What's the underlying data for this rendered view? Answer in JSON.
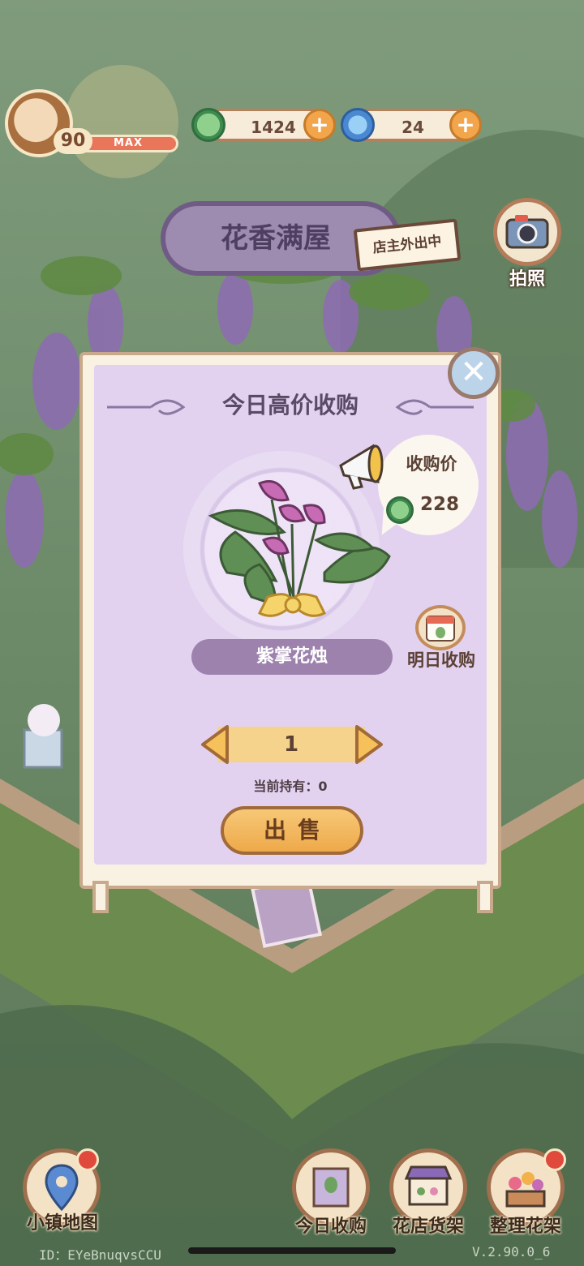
{
  "hud": {
    "level": "90",
    "level_status": "MAX",
    "currency_1": {
      "icon": "clover-coin-icon",
      "value": "1424"
    },
    "currency_2": {
      "icon": "swirl-gem-icon",
      "value": "24"
    }
  },
  "shop": {
    "name": "花香满屋",
    "status_sign": "店主外出中",
    "camera_label": "拍照"
  },
  "board": {
    "title": "今日高价收购",
    "price_label": "收购价",
    "price_value": "228",
    "item_name": "紫掌花烛",
    "tomorrow_label": "明日收购",
    "quantity": "1",
    "held_label": "当前持有：0",
    "sell_label": "出售"
  },
  "nav": {
    "map": "小镇地图",
    "today": "今日收购",
    "shelf": "花店货架",
    "arrange": "整理花架"
  },
  "footer": {
    "id": "ID：EYeBnuqvsCCU",
    "version": "V.2.90.0_6"
  },
  "colors": {
    "board_inner": "#e2d2f0",
    "accent_orange": "#f2a54a",
    "name_pill": "#9c82ad"
  }
}
